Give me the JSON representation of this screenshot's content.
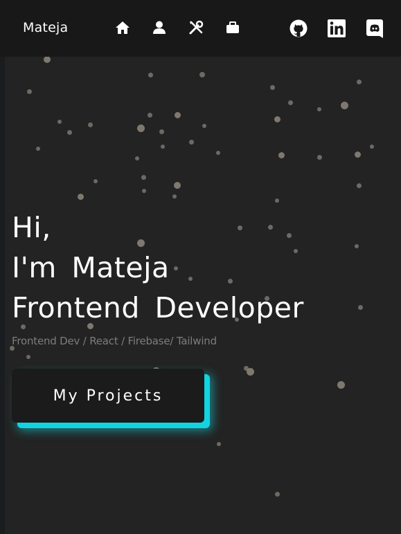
{
  "navbar": {
    "brand": "Mateja",
    "icons": [
      "home-icon",
      "user-icon",
      "tools-icon",
      "briefcase-icon"
    ],
    "social": [
      "github-icon",
      "linkedin-icon",
      "discord-icon"
    ]
  },
  "hero": {
    "line1": "Hi,",
    "line2": "I'm Mateja",
    "line3": "Frontend Developer",
    "subtitle": "Frontend Dev / React / Firebase/ Tailwind",
    "cta_label": "My Projects"
  },
  "colors": {
    "background": "#232323",
    "navbar": "#181818",
    "accent": "#12d3e0",
    "particle": "#8e877d"
  }
}
